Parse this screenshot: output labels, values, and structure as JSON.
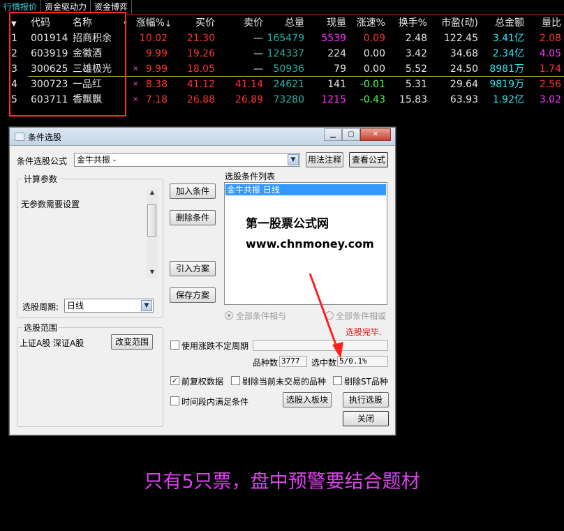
{
  "tabs": [
    "行情报价",
    "资金驱动力",
    "资金博弈"
  ],
  "table": {
    "headers": {
      "code": "代码",
      "name": "名称",
      "chg": "涨幅%",
      "buy": "买价",
      "sell": "卖价",
      "vol": "总量",
      "cur": "现量",
      "spd": "涨速%",
      "turn": "换手%",
      "pe": "市盈(动)",
      "amt": "总金额",
      "ratio": "量比"
    },
    "rows": [
      {
        "idx": "1",
        "code": "001914",
        "name": "招商积余",
        "mark": "",
        "chg": "10.02",
        "buy": "21.30",
        "sell": "—",
        "vol": "165479",
        "cur": "5539",
        "spd": "0.09",
        "turn": "2.48",
        "pe": "122.45",
        "amt": "3.41亿",
        "ratio": "2.08"
      },
      {
        "idx": "2",
        "code": "603919",
        "name": "金徽酒",
        "mark": "",
        "chg": "9.99",
        "buy": "19.26",
        "sell": "—",
        "vol": "124337",
        "cur": "224",
        "spd": "0.00",
        "turn": "3.42",
        "pe": "34.68",
        "amt": "2.34亿",
        "ratio": "4.05"
      },
      {
        "idx": "3",
        "code": "300625",
        "name": "三雄极光",
        "mark": "×",
        "chg": "9.99",
        "buy": "18.05",
        "sell": "—",
        "vol": "50936",
        "cur": "79",
        "spd": "0.00",
        "turn": "5.52",
        "pe": "24.50",
        "amt": "8981万",
        "ratio": "1.74"
      },
      {
        "idx": "4",
        "code": "300723",
        "name": "一品红",
        "mark": "×",
        "chg": "8.38",
        "buy": "41.12",
        "sell": "41.14",
        "vol": "24621",
        "cur": "141",
        "spd": "-0.01",
        "turn": "5.31",
        "pe": "29.64",
        "amt": "9819万",
        "ratio": "2.56"
      },
      {
        "idx": "5",
        "code": "603711",
        "name": "香飘飘",
        "mark": "×",
        "chg": "7.18",
        "buy": "26.88",
        "sell": "26.89",
        "vol": "73280",
        "cur": "1215",
        "spd": "-0.43",
        "turn": "15.83",
        "pe": "63.93",
        "amt": "1.92亿",
        "ratio": "3.02"
      }
    ]
  },
  "dialog": {
    "title": "条件选股",
    "formula_label": "条件选股公式",
    "formula_value": "金牛共振        -",
    "usage_btn": "用法注释",
    "view_btn": "查看公式",
    "params_group": "计算参数",
    "params_text": "无参数需要设置",
    "period_label": "选股周期:",
    "period_value": "日线",
    "add_btn": "加入条件",
    "del_btn": "删除条件",
    "import_btn": "引入方案",
    "save_btn": "保存方案",
    "list_label": "选股条件列表",
    "list_item": "金牛共振   日线",
    "watermark1": "第一股票公式网",
    "watermark2": "www.chnmoney.com",
    "radio_and": "全部条件相与",
    "radio_or": "全部条件相或",
    "status": "选股完毕.",
    "range_group": "选股范围",
    "range_text": "上证A股 深证A股",
    "range_btn": "改变范围",
    "chk_uncertain": "使用涨跌不定周期",
    "count_label": "品种数",
    "count_value": "3777",
    "selected_label": "选中数",
    "selected_value": "5/0.1%",
    "chk_fq": "前复权数据",
    "chk_notrade": "剔除当前未交易的品种",
    "chk_st": "剔除ST品种",
    "chk_period": "时间段内满足条件",
    "to_block_btn": "选股入板块",
    "exec_btn": "执行选股",
    "close_btn": "关闭"
  },
  "caption": "只有5只票，盘中预警要结合题材"
}
